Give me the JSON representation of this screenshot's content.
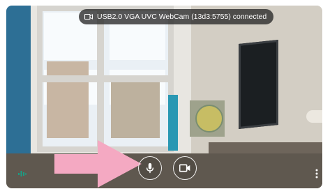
{
  "status": {
    "text": "USB2.0 VGA UVC WebCam (13d3:5755)  connected",
    "icon": "videocam-outline-icon"
  },
  "controls": {
    "mic_icon": "microphone-icon",
    "camera_icon": "videocam-icon",
    "audio_level_icon": "audio-level-icon",
    "more_icon": "more-vert-icon"
  },
  "colors": {
    "pill_bg": "#282828",
    "arrow": "#f4a9c2",
    "audio_level": "#1a9e84"
  }
}
